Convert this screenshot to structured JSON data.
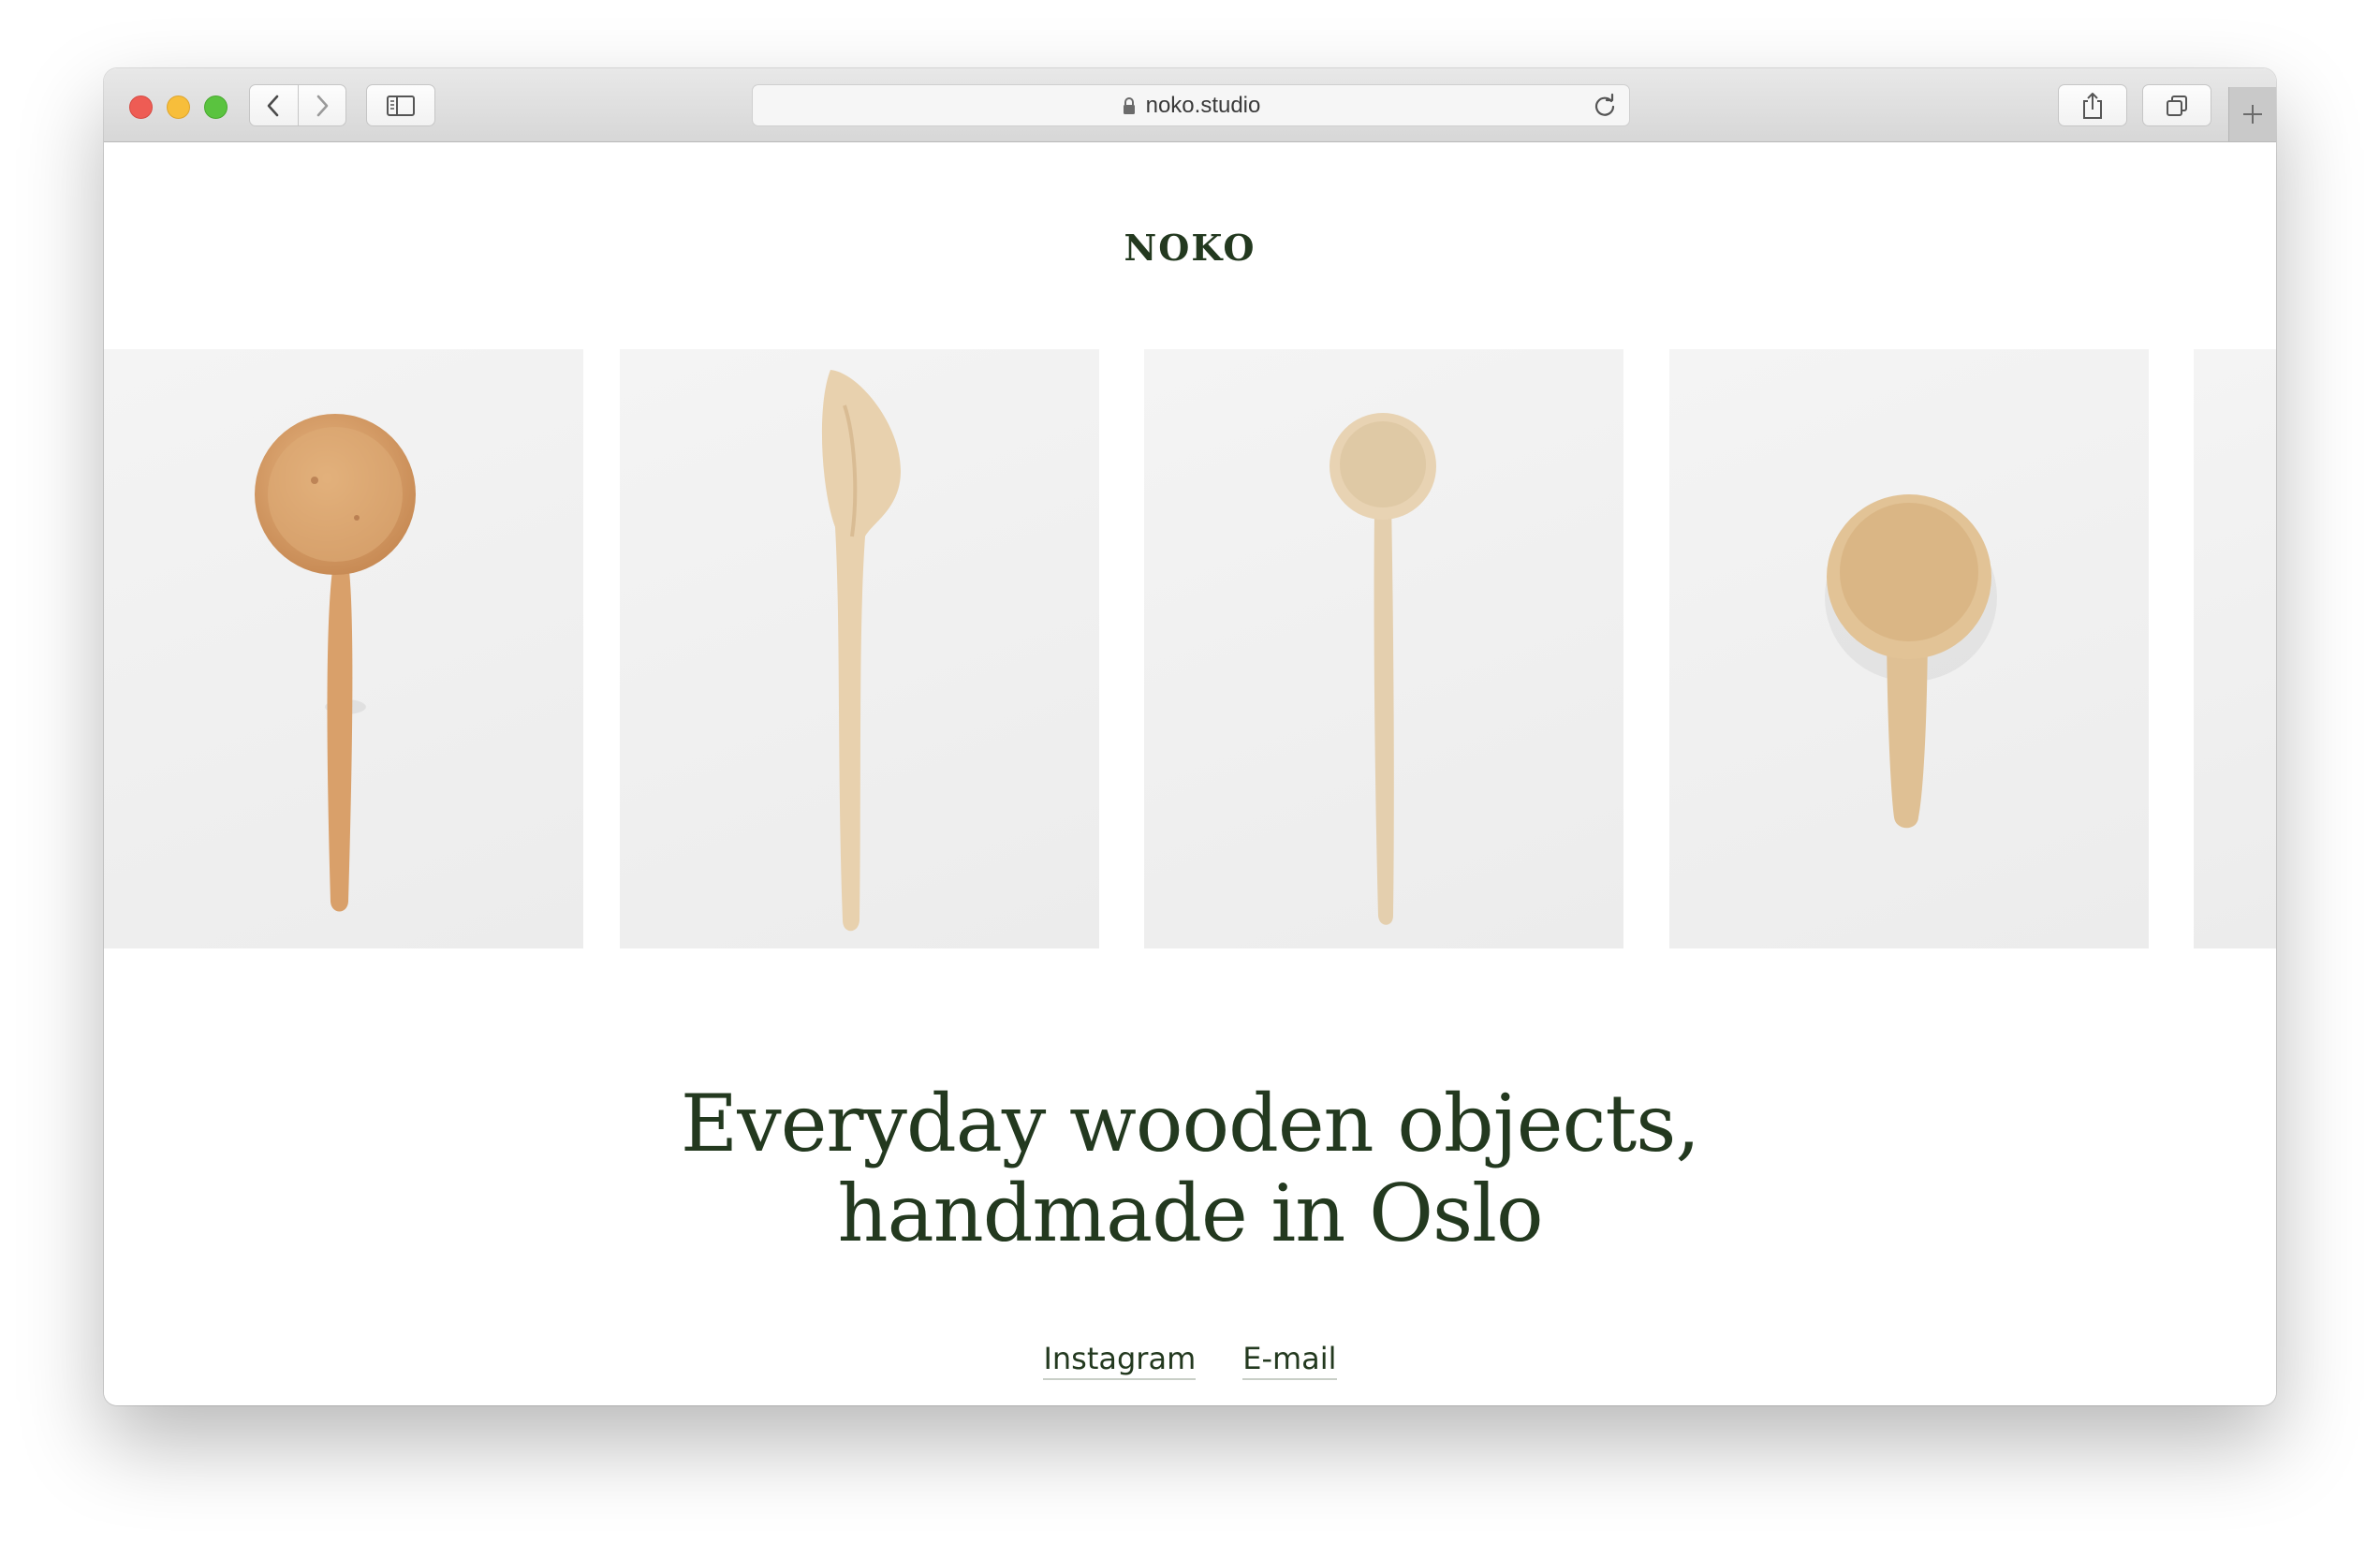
{
  "browser": {
    "url": "noko.studio",
    "icons": {
      "back": "chevron-left-icon",
      "forward": "chevron-right-icon",
      "sidebar": "sidebar-icon",
      "lock": "lock-icon",
      "reload": "reload-icon",
      "share": "share-icon",
      "tabs": "tabs-icon",
      "new_tab": "plus-icon"
    }
  },
  "site": {
    "logo": "NOKO",
    "headline_line1": "Everyday wooden objects,",
    "headline_line2": "handmade in Oslo",
    "links": [
      {
        "label": "Instagram"
      },
      {
        "label": "E-mail"
      }
    ],
    "products": [
      {
        "image": "round wooden spoon with long handle"
      },
      {
        "image": "wooden spatula"
      },
      {
        "image": "small wooden spoon with thin handle"
      },
      {
        "image": "wooden scoop with short handle"
      },
      {
        "image": "partially visible product"
      }
    ]
  },
  "colors": {
    "brand_green": "#23391f",
    "wood_light": "#e6cfab",
    "wood_warm": "#d9a46e"
  }
}
